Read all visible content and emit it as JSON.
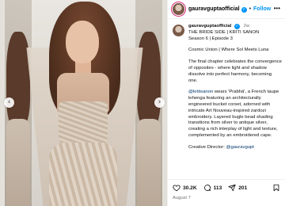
{
  "post": {
    "username": "gauravguptaofficial",
    "follow_label": "Follow",
    "separator": "•",
    "caption_lines": [
      "THE BRIDE SIDE | KRITI SANON",
      "Season 6 | Episode 3"
    ],
    "subtitle": "Cosmic Union | Where Sol Meets Luna",
    "paragraph_1": "The final chapter celebrates the convergence of opposites - where light and shadow dissolve into perfect harmony, becoming one.",
    "mention": "@kritisanon",
    "paragraph_2": " wears 'Prabhā', a French taupe lehenga featuring an architecturally engineered bucket corset, adorned with intricate Art Nouveau-inspired zardozi embroidery. Layered bugle bead shading transitions from silver to antique silver, creating a rich interplay of light and texture, complemented by an embroidered cape.",
    "credit_label": "Creative Director: ",
    "credit_mention": "@gauravgupt",
    "time_ago": "2w",
    "date": "August 7"
  },
  "stats": {
    "likes": "30.2K",
    "comments": "113",
    "shares": "201"
  },
  "icons": {
    "more": "more-dots-icon",
    "like": "heart-icon",
    "comment": "comment-bubble-icon",
    "share": "paper-plane-icon",
    "save": "bookmark-icon",
    "verified": "verified-badge-icon",
    "prev": "chevron-left-icon",
    "next": "chevron-right-icon"
  },
  "colors": {
    "link": "#00376b",
    "follow": "#0095f6",
    "meta": "#737373"
  }
}
